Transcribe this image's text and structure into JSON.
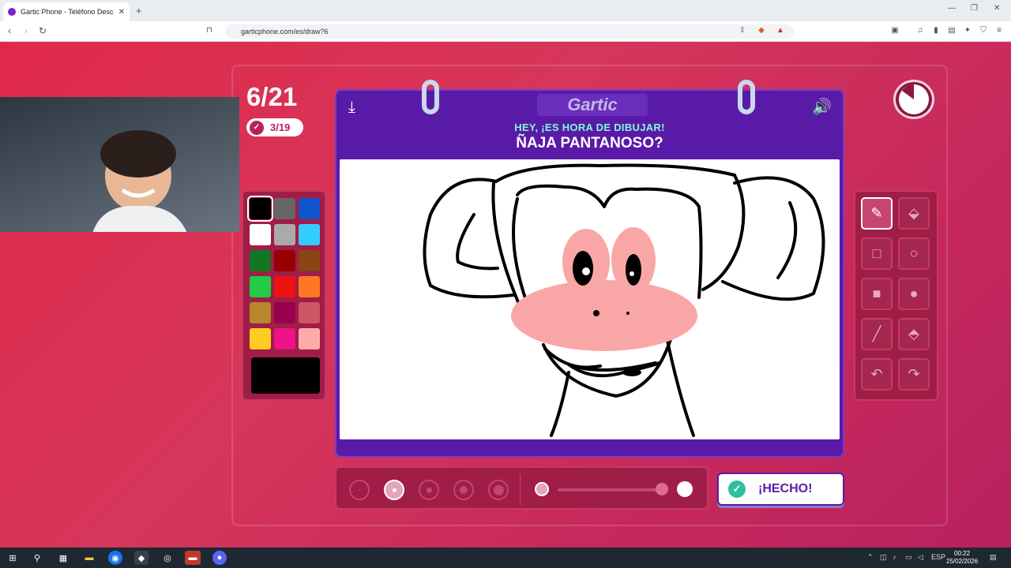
{
  "browser": {
    "tab_title": "Gartic Phone - Teléfono Descon",
    "url": "garticphone.com/es/draw?6"
  },
  "game": {
    "round": "6/21",
    "done_count": "3/19",
    "logo": "Gartic",
    "hint": "HEY, ¡ES HORA DE DIBUJAR!",
    "prompt": "ÑAJA PANTANOSO?",
    "done_button": "¡HECHO!"
  },
  "palette": {
    "colors": [
      "#000000",
      "#666666",
      "#1155cc",
      "#ffffff",
      "#aaaaaa",
      "#33ccff",
      "#117722",
      "#990000",
      "#8b4513",
      "#22cc44",
      "#ee1111",
      "#ff7722",
      "#b8862b",
      "#99004d",
      "#cc5566",
      "#ffcc22",
      "#ee1188",
      "#ffaaaa"
    ],
    "selected": "#000000",
    "current": "#000000"
  },
  "tools": [
    "pencil-icon",
    "eraser-icon",
    "rect-outline-icon",
    "circle-outline-icon",
    "rect-filled-icon",
    "circle-filled-icon",
    "line-icon",
    "fill-bucket-icon",
    "undo-icon",
    "redo-icon"
  ],
  "taskbar": {
    "lang": "ESP",
    "time": "00:22",
    "date": "25/02/2026"
  }
}
